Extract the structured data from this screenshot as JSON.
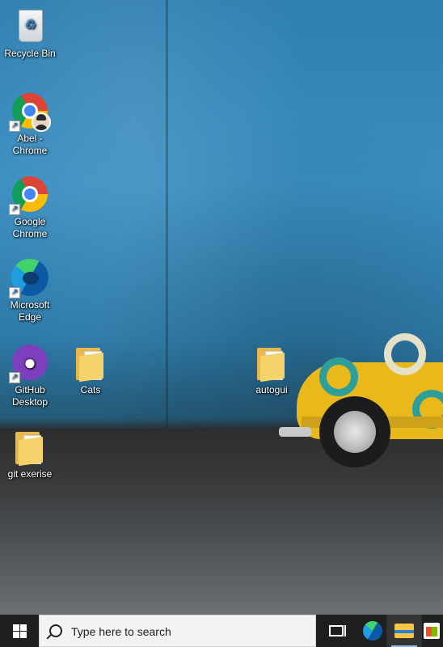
{
  "desktop": {
    "icons": [
      {
        "label": "Recycle Bin",
        "icon": "recycle-bin-icon"
      },
      {
        "label": "Abel - Chrome",
        "icon": "chrome-profile-icon"
      },
      {
        "label": "Google Chrome",
        "icon": "chrome-icon"
      },
      {
        "label": "Microsoft Edge",
        "icon": "edge-icon"
      },
      {
        "label": "GitHub Desktop",
        "icon": "github-desktop-icon"
      },
      {
        "label": "Cats",
        "icon": "folder-icon"
      },
      {
        "label": "autogui",
        "icon": "folder-icon"
      },
      {
        "label": "git exerise",
        "icon": "folder-icon"
      }
    ]
  },
  "taskbar": {
    "search_placeholder": "Type here to search",
    "pinned": [
      "start-icon",
      "task-view-icon",
      "edge-icon",
      "file-explorer-icon",
      "store-icon"
    ],
    "active_app": "file-explorer"
  },
  "colors": {
    "taskbar_bg": "#1f1f1f",
    "search_bg": "#f3f3f3",
    "active_indicator": "#8fb9e8"
  }
}
